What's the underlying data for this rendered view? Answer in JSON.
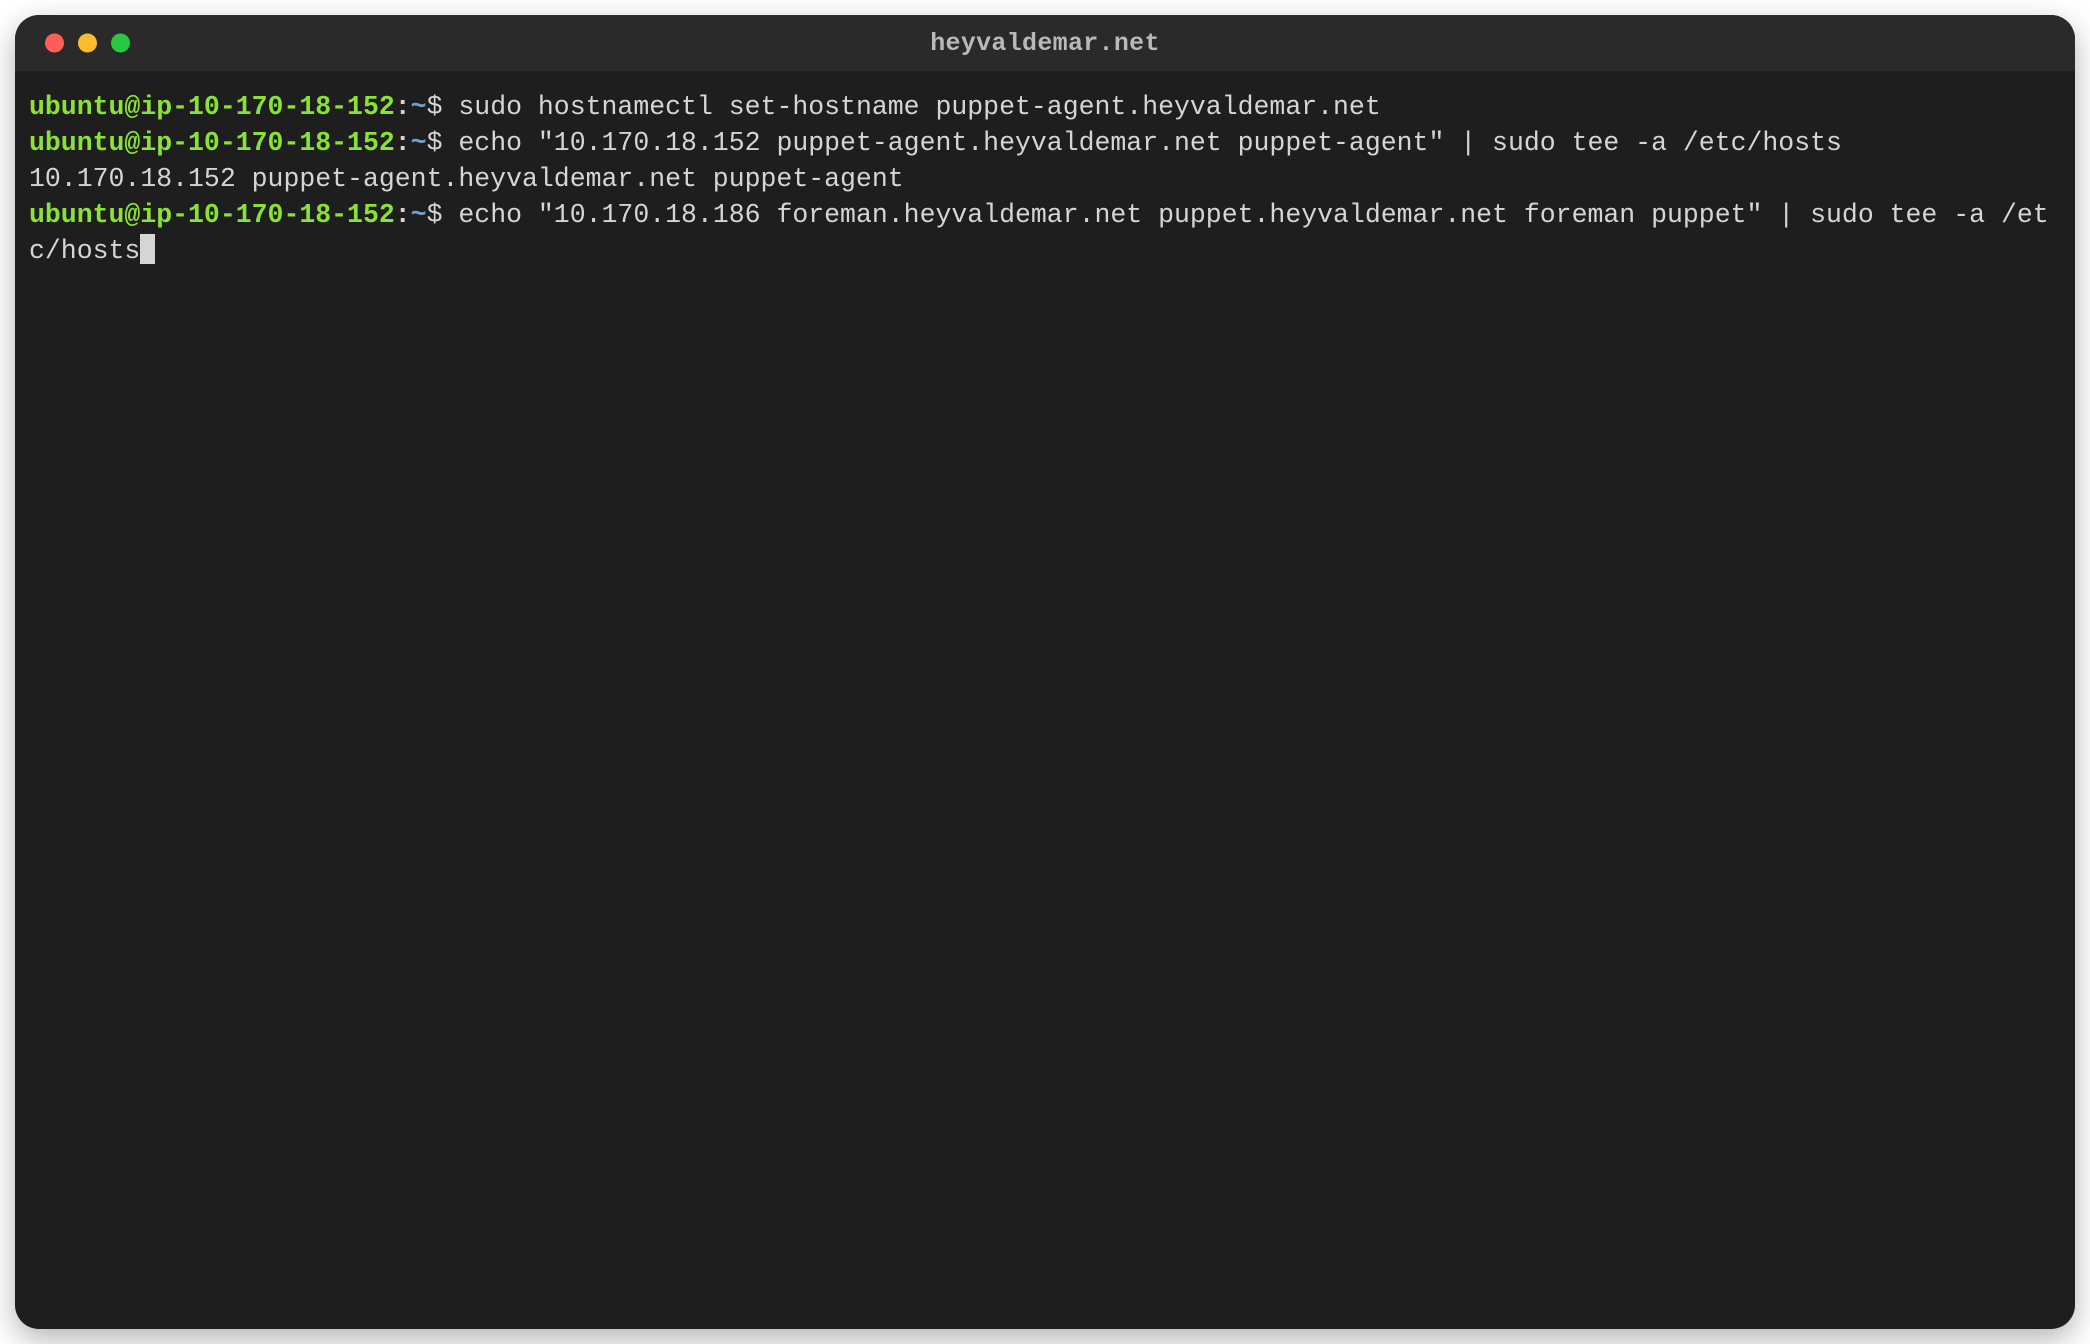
{
  "window": {
    "title": "heyvaldemar.net"
  },
  "prompt": {
    "user_host": "ubuntu@ip-10-170-18-152",
    "separator": ":",
    "path": "~",
    "symbol": "$"
  },
  "lines": {
    "cmd1": "sudo hostnamectl set-hostname puppet-agent.heyvaldemar.net",
    "cmd2": "echo \"10.170.18.152 puppet-agent.heyvaldemar.net puppet-agent\" | sudo tee -a /etc/hosts",
    "out2": "10.170.18.152 puppet-agent.heyvaldemar.net puppet-agent",
    "cmd3": "echo \"10.170.18.186 foreman.heyvaldemar.net puppet.heyvaldemar.net foreman puppet\" | sudo tee -a /etc/hosts"
  }
}
